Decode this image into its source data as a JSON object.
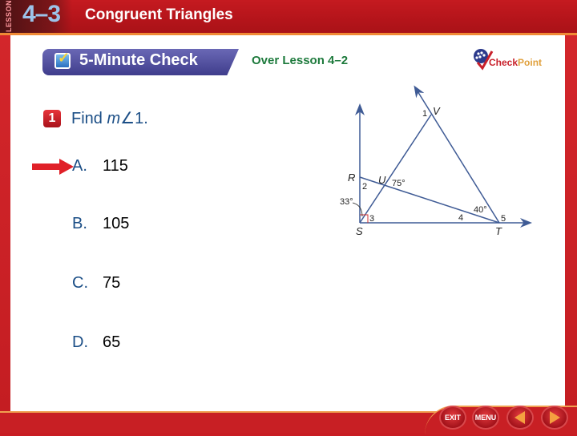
{
  "header": {
    "lesson_tab": "LESSON",
    "lesson_number": "4–3",
    "lesson_title": "Congruent Triangles"
  },
  "banner": {
    "title": "5-Minute Check",
    "subtitle": "Over Lesson 4–2",
    "logo_check": "Check",
    "logo_point": "Point"
  },
  "question": {
    "number": "1",
    "prefix": "Find ",
    "var": "m",
    "angle_symbol": "∠",
    "suffix": "1."
  },
  "answers": [
    {
      "letter": "A.",
      "value": "115",
      "selected": true
    },
    {
      "letter": "B.",
      "value": "105",
      "selected": false
    },
    {
      "letter": "C.",
      "value": "75",
      "selected": false
    },
    {
      "letter": "D.",
      "value": "65",
      "selected": false
    }
  ],
  "diagram": {
    "points": {
      "R": "R",
      "S": "S",
      "T": "T",
      "U": "U",
      "V": "V"
    },
    "angle_labels": {
      "a1": "1",
      "a2": "2",
      "a3": "3",
      "a4": "4",
      "a5": "5"
    },
    "given": {
      "u_angle": "75°",
      "t_angle": "40°",
      "s_angle": "33°"
    }
  },
  "nav": {
    "exit": "EXIT",
    "menu": "MENU"
  },
  "colors": {
    "frame_red": "#c81f24",
    "accent_orange": "#f08a35",
    "banner_purple": "#4a479a",
    "text_blue": "#1b4e86",
    "lesson_green": "#1d7a3c",
    "diagram_line": "#3f5b95"
  }
}
